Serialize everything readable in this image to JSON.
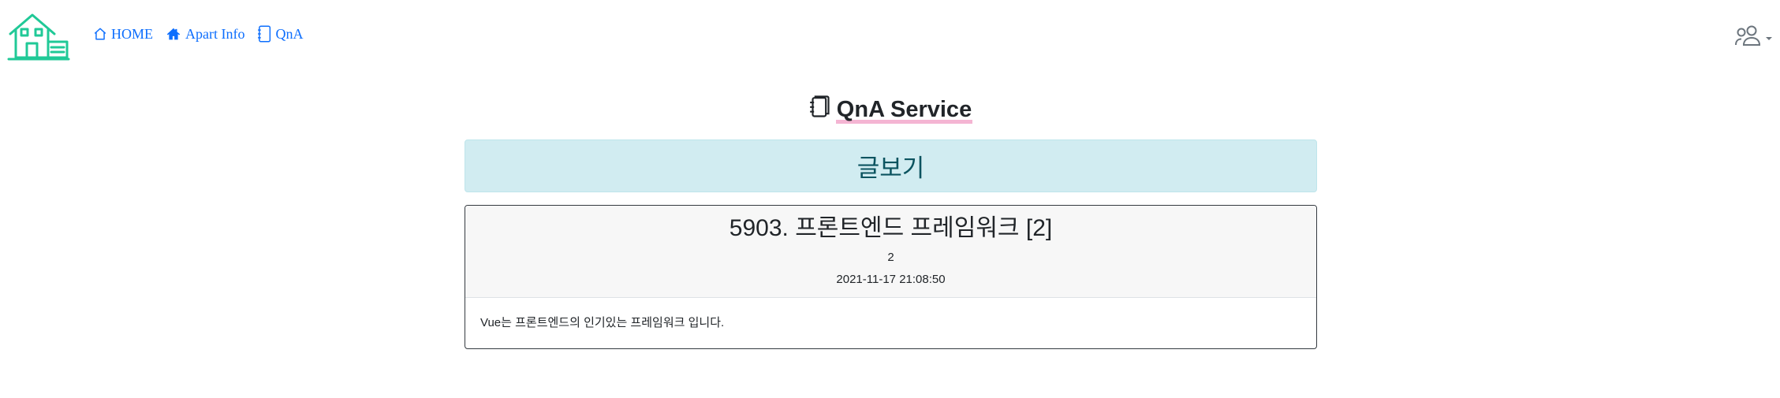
{
  "nav": {
    "logo_icon": "house-logo-icon",
    "links": [
      {
        "label": "HOME",
        "icon": "house-icon"
      },
      {
        "label": "Apart Info",
        "icon": "house-fill-icon"
      },
      {
        "label": "QnA",
        "icon": "journal-icon"
      }
    ],
    "user_icon": "people-icon",
    "accent_color": "#0d6efd",
    "logo_color": "#20c997"
  },
  "page": {
    "service_title": "QnA Service",
    "service_icon": "journals-icon",
    "banner_label": "글보기",
    "banner_color": "#d1ecf1"
  },
  "article": {
    "title": "5903. 프론트엔드 프레임워크 [2]",
    "writer": "2",
    "date": "2021-11-17 21:08:50",
    "content": "Vue는 프론트엔드의 인기있는 프레임워크 입니다."
  }
}
